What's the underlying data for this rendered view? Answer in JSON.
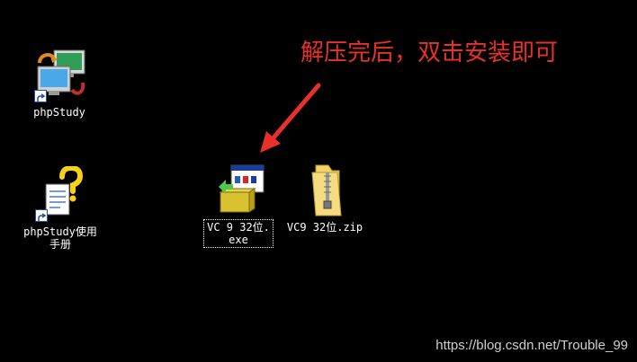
{
  "desktop": {
    "icons": [
      {
        "label": "phpStudy",
        "icon": "phpstudy-app-icon"
      },
      {
        "label": "phpStudy使用\n手册",
        "icon": "help-document-icon"
      },
      {
        "label": "VC 9 32位.\nexe",
        "icon": "installer-exe-icon"
      },
      {
        "label": "VC9 32位.zip",
        "icon": "zip-folder-icon"
      }
    ]
  },
  "annotation": {
    "text": "解压完后，双击安装即可",
    "color": "#e8302a"
  },
  "watermark": {
    "text": "https://blog.csdn.net/Trouble_99"
  }
}
